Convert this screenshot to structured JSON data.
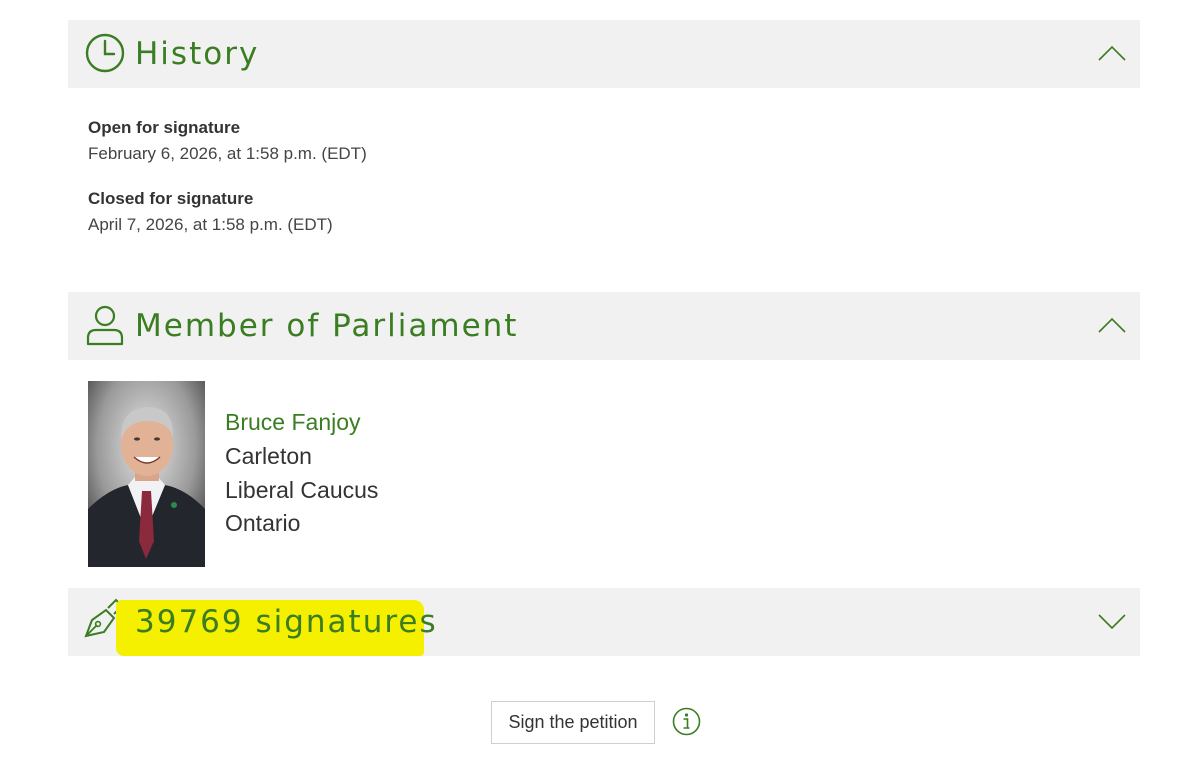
{
  "history": {
    "title": "History",
    "icon": "clock-icon",
    "expanded": true,
    "open_label": "Open for signature",
    "open_value": "February 6, 2026, at 1:58 p.m. (EDT)",
    "closed_label": "Closed for signature",
    "closed_value": "April 7, 2026, at 1:58 p.m. (EDT)"
  },
  "member": {
    "title": "Member of Parliament",
    "icon": "person-icon",
    "expanded": true,
    "name": "Bruce Fanjoy",
    "riding": "Carleton",
    "caucus": "Liberal Caucus",
    "province": "Ontario"
  },
  "signatures": {
    "title": "39769 signatures",
    "icon": "fountain-pen-icon",
    "expanded": false,
    "count": 39769
  },
  "actions": {
    "sign_label": "Sign the petition",
    "info_icon": "info-icon"
  },
  "colors": {
    "accent": "#3a7d22",
    "header_bg": "#f1f1f1",
    "highlight": "#f5ef00"
  }
}
